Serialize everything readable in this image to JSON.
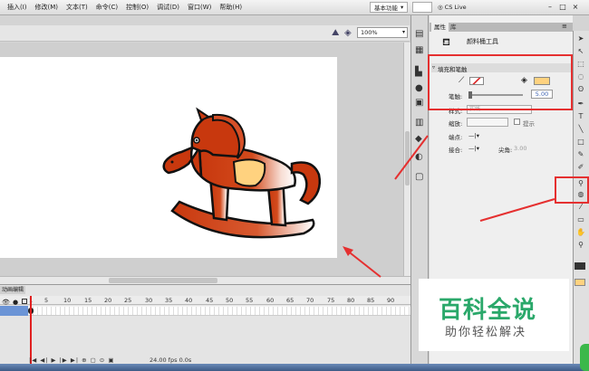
{
  "menu": {
    "items": [
      "插入(I)",
      "修改(M)",
      "文本(T)",
      "命令(C)",
      "控制(O)",
      "调试(D)",
      "窗口(W)",
      "帮助(H)"
    ],
    "workspace": "基本功能",
    "cslive": "CS Live"
  },
  "stage": {
    "zoom": "100%"
  },
  "timeline": {
    "tab": "动画编辑",
    "frames": [
      "1",
      "5",
      "10",
      "15",
      "20",
      "25",
      "30",
      "35",
      "40",
      "45",
      "50",
      "55",
      "60",
      "65",
      "70",
      "75",
      "80",
      "85",
      "90"
    ],
    "fps": "24.00 fps",
    "time": "0.0s"
  },
  "panel": {
    "tabs": [
      "属性",
      "库"
    ],
    "tool_name": "颜料桶工具",
    "section": "填充和笔触",
    "stroke_label": "笔触:",
    "stroke_value": "5.00",
    "style_label": "样式:",
    "style_value": "实线",
    "scale_label": "缩放:",
    "hint_label": "提示",
    "cap_label": "端点:",
    "cap_value": "—|▾",
    "join_label": "接合:",
    "join_value": "—|▾",
    "miter_label": "尖角:",
    "miter_value": "3.00"
  },
  "colors": {
    "fill": "#ffd27f",
    "horse": "#c8380e",
    "annotation": "#e53030"
  },
  "watermark": {
    "title": "百科全说",
    "subtitle": "助你轻松解决"
  }
}
